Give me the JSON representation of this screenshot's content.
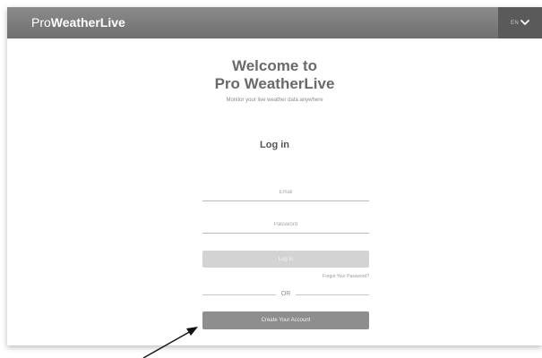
{
  "header": {
    "brand_prefix": "Pro",
    "brand_name": "WeatherLive",
    "language": "EN",
    "language_icon": "chevron-down-icon"
  },
  "welcome": {
    "line1": "Welcome to",
    "line2": "Pro WeatherLive",
    "subtitle": "Monitor your live weather data anywhere"
  },
  "login": {
    "heading": "Log in",
    "email_placeholder": "Email",
    "password_placeholder": "Password",
    "login_button": "Log in",
    "forgot_link": "Forgot Your Password?",
    "or_text": "OR",
    "create_account_button": "Create Your Account"
  },
  "annotation": {
    "icon": "pointer-arrow-icon"
  },
  "colors": {
    "header_background": "#7d7d7d",
    "language_background": "#5a5a5a",
    "login_button": "#d3d3d3",
    "create_button": "#8e8e8e"
  }
}
